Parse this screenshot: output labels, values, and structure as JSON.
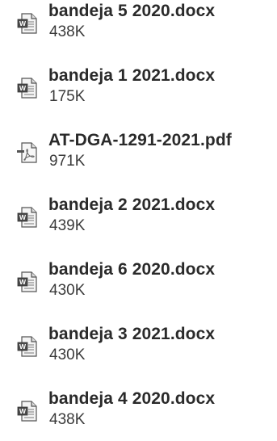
{
  "attachments": [
    {
      "name": "bandeja 5 2020.docx",
      "size": "438K",
      "icon": "word-document-icon"
    },
    {
      "name": "bandeja 1 2021.docx",
      "size": "175K",
      "icon": "word-document-icon"
    },
    {
      "name": "AT-DGA-1291-2021.pdf",
      "size": "971K",
      "icon": "pdf-document-icon"
    },
    {
      "name": "bandeja 2 2021.docx",
      "size": "439K",
      "icon": "word-document-icon"
    },
    {
      "name": "bandeja 6 2020.docx",
      "size": "430K",
      "icon": "word-document-icon"
    },
    {
      "name": "bandeja 3 2021.docx",
      "size": "430K",
      "icon": "word-document-icon"
    },
    {
      "name": "bandeja 4 2020.docx",
      "size": "438K",
      "icon": "word-document-icon"
    }
  ]
}
